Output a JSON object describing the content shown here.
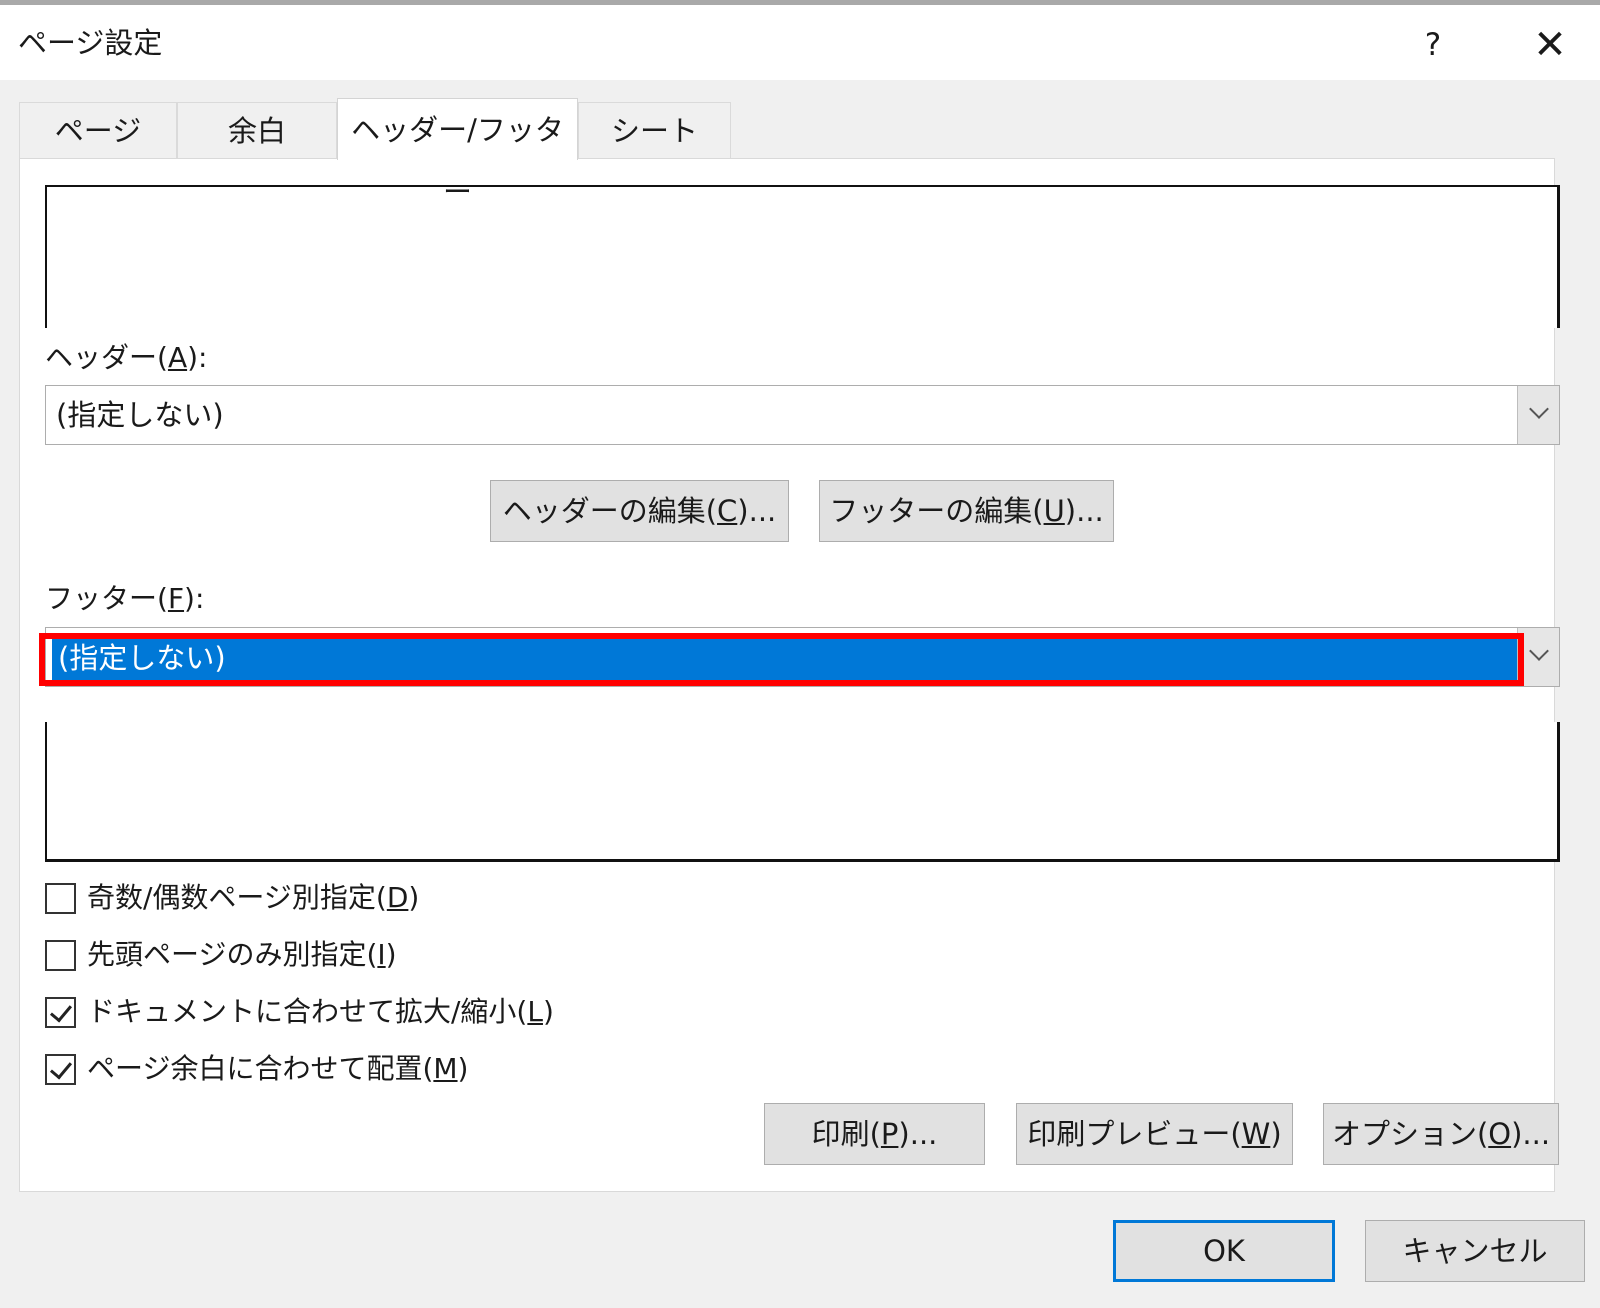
{
  "window": {
    "title": "ページ設定",
    "help_label": "?",
    "close_label": "✕"
  },
  "tabs": [
    {
      "label": "ページ",
      "active": false
    },
    {
      "label": "余白",
      "active": false
    },
    {
      "label": "ヘッダー/フッター",
      "active": true
    },
    {
      "label": "シート",
      "active": false
    }
  ],
  "header": {
    "label_prefix": "ヘッダー(",
    "accel": "A",
    "label_suffix": "):",
    "selected_value": "(指定しない)"
  },
  "edit_buttons": {
    "header_prefix": "ヘッダーの編集(",
    "header_accel": "C",
    "header_suffix": ")...",
    "footer_prefix": "フッターの編集(",
    "footer_accel": "U",
    "footer_suffix": ")..."
  },
  "footer": {
    "label_prefix": "フッター(",
    "accel": "F",
    "label_suffix": "):",
    "selected_value": "(指定しない)",
    "highlight_color": "#ff0000",
    "selection_color": "#0078d7"
  },
  "options": [
    {
      "prefix": "奇数/偶数ページ別指定(",
      "accel": "D",
      "suffix": ")",
      "checked": false
    },
    {
      "prefix": "先頭ページのみ別指定(",
      "accel": "I",
      "suffix": ")",
      "checked": false
    },
    {
      "prefix": "ドキュメントに合わせて拡大/縮小(",
      "accel": "L",
      "suffix": ")",
      "checked": true
    },
    {
      "prefix": "ページ余白に合わせて配置(",
      "accel": "M",
      "suffix": ")",
      "checked": true
    }
  ],
  "action_buttons": {
    "print_prefix": "印刷(",
    "print_accel": "P",
    "print_suffix": ")...",
    "preview_prefix": "印刷プレビュー(",
    "preview_accel": "W",
    "preview_suffix": ")",
    "options_prefix": "オプション(",
    "options_accel": "O",
    "options_suffix": ")..."
  },
  "footer_buttons": {
    "ok": "OK",
    "cancel": "キャンセル"
  }
}
